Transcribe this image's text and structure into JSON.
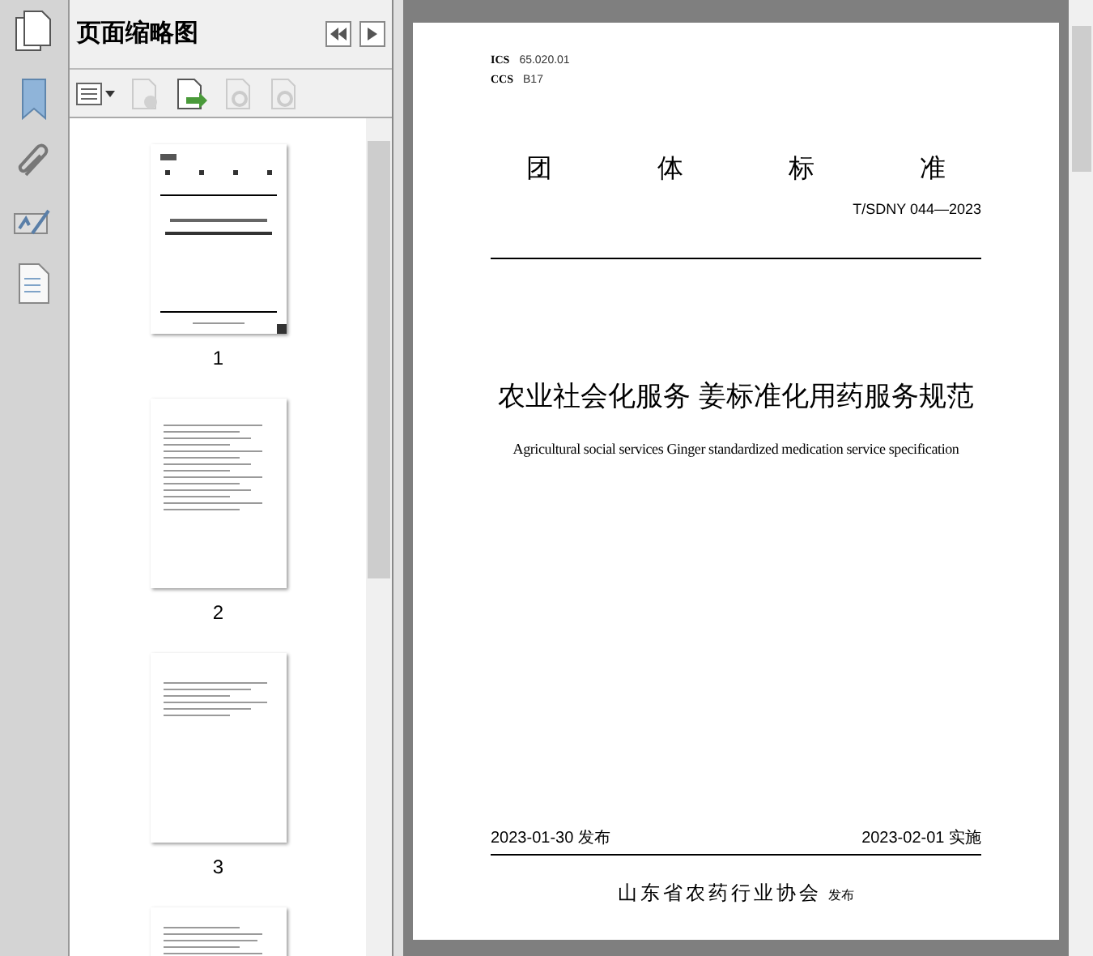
{
  "panel": {
    "title": "页面缩略图"
  },
  "thumbnails": [
    {
      "label": "1",
      "kind": "cover"
    },
    {
      "label": "2",
      "kind": "toc"
    },
    {
      "label": "3",
      "kind": "text"
    },
    {
      "kind": "body"
    }
  ],
  "document": {
    "ics_label": "ICS",
    "ics": "65.020.01",
    "ccs_label": "CCS",
    "ccs": "B17",
    "category": [
      "团",
      "体",
      "标",
      "准"
    ],
    "code": "T/SDNY 044—2023",
    "title": "农业社会化服务 姜标准化用药服务规范",
    "title_en": "Agricultural social services Ginger standardized medication service specification",
    "published": "2023-01-30 发布",
    "effective": "2023-02-01 实施",
    "publisher": "山东省农药行业协会",
    "publisher_suffix": "发布"
  }
}
